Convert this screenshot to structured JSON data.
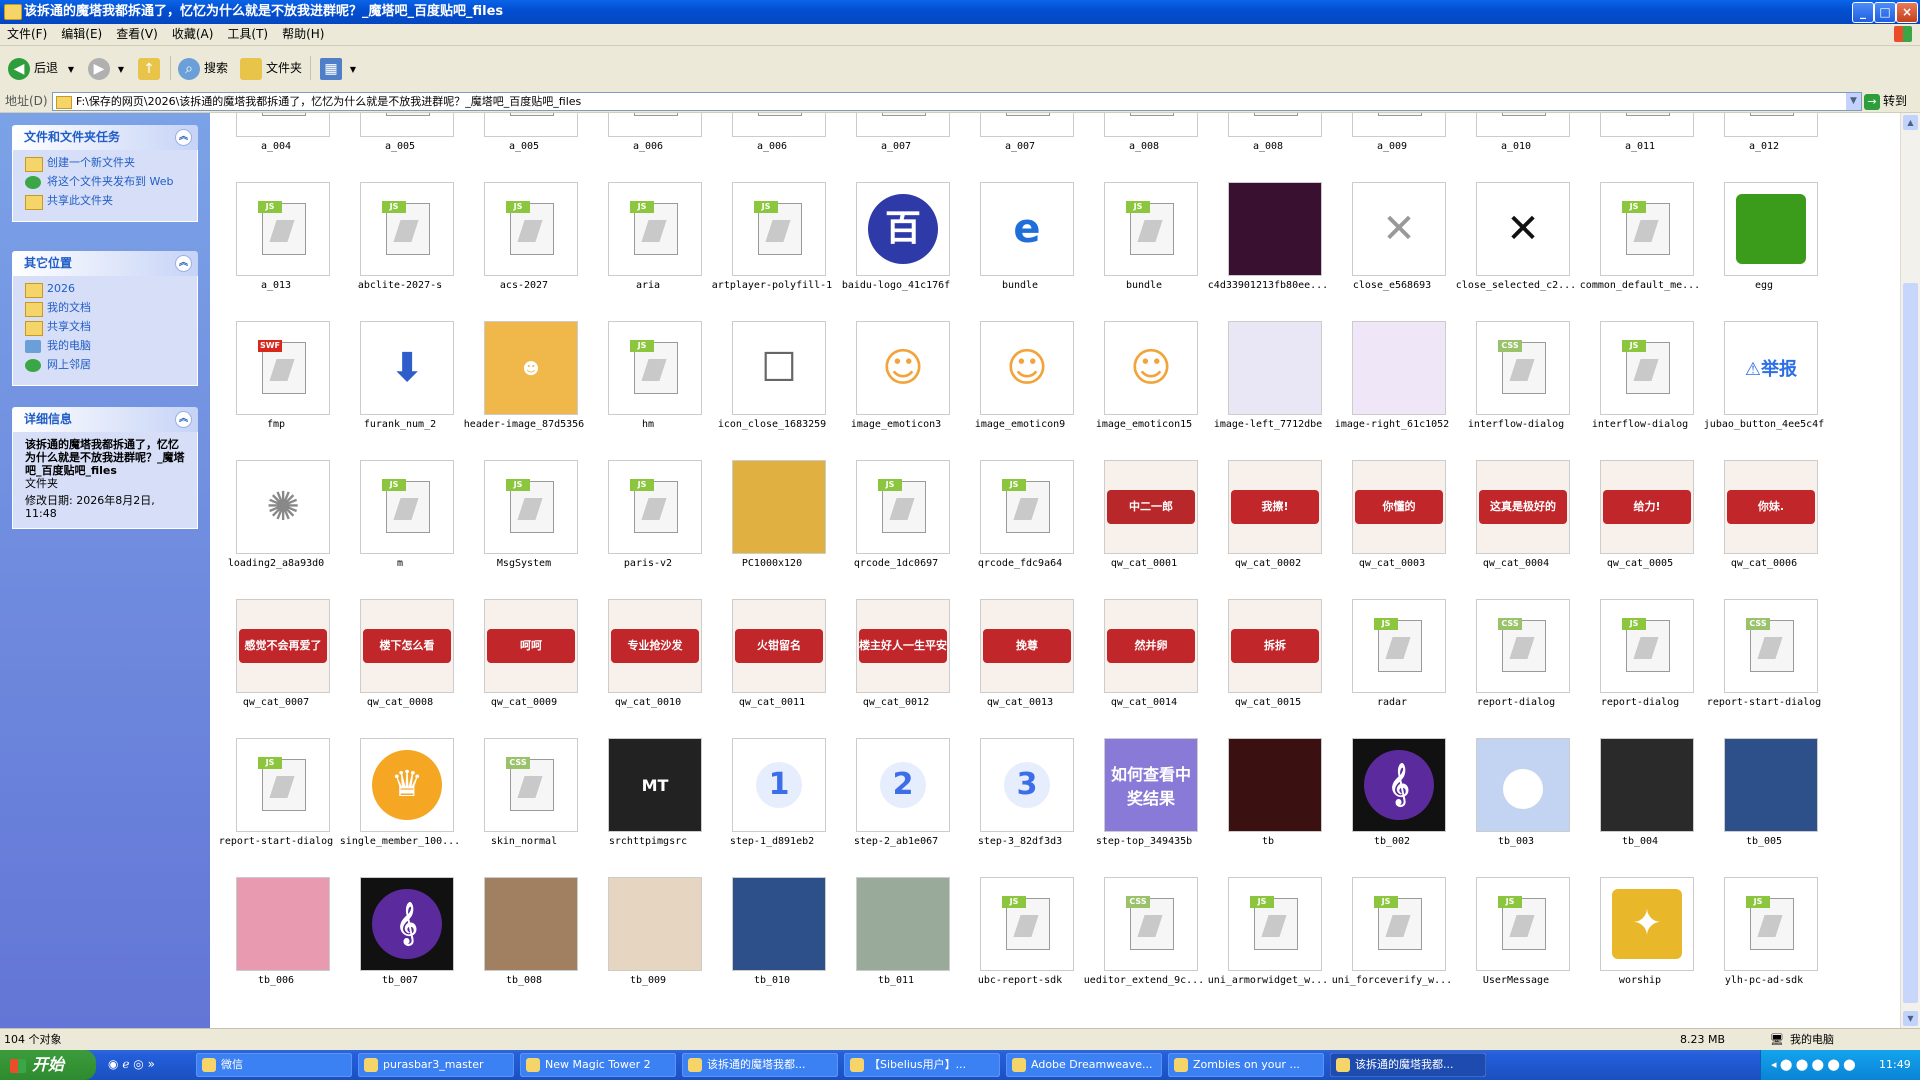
{
  "window": {
    "title": "该拆通的魔塔我都拆通了，忆忆为什么就是不放我进群呢？_魔塔吧_百度贴吧_files",
    "minimize": "_",
    "maximize": "□",
    "close": "×"
  },
  "menu": [
    "文件(F)",
    "编辑(E)",
    "查看(V)",
    "收藏(A)",
    "工具(T)",
    "帮助(H)"
  ],
  "toolbar": {
    "back": "后退",
    "search": "搜索",
    "folders": "文件夹"
  },
  "address": {
    "label": "地址(D)",
    "path": "F:\\保存的网页\\2026\\该拆通的魔塔我都拆通了，忆忆为什么就是不放我进群呢？_魔塔吧_百度贴吧_files",
    "go": "转到"
  },
  "tasks_panel": {
    "title": "文件和文件夹任务",
    "items": [
      "创建一个新文件夹",
      "将这个文件夹发布到 Web",
      "共享此文件夹"
    ]
  },
  "places_panel": {
    "title": "其它位置",
    "items": [
      "2026",
      "我的文档",
      "共享文档",
      "我的电脑",
      "网上邻居"
    ]
  },
  "details_panel": {
    "title": "详细信息",
    "name": "该拆通的魔塔我都拆通了，忆忆为什么就是不放我进群呢？_魔塔吧_百度贴吧_files",
    "type": "文件夹",
    "modified": "修改日期: 2026年8月2日, 11:48"
  },
  "file_rows": [
    [
      {
        "name": "a_004",
        "kind": "partial",
        "icon": "js-file-icon"
      },
      {
        "name": "a_005",
        "kind": "partial",
        "icon": "css-file-icon"
      },
      {
        "name": "a_005",
        "kind": "partial",
        "icon": "js-file-icon"
      },
      {
        "name": "a_006",
        "kind": "partial",
        "icon": "css-file-icon"
      },
      {
        "name": "a_006",
        "kind": "partial",
        "icon": "js-file-icon"
      },
      {
        "name": "a_007",
        "kind": "partial",
        "icon": "css-file-icon"
      },
      {
        "name": "a_007",
        "kind": "partial",
        "icon": "js-file-icon"
      },
      {
        "name": "a_008",
        "kind": "partial",
        "icon": "css-file-icon"
      },
      {
        "name": "a_008",
        "kind": "partial",
        "icon": "js-file-icon"
      },
      {
        "name": "a_009",
        "kind": "partial",
        "icon": "js-file-icon"
      },
      {
        "name": "a_010",
        "kind": "partial",
        "icon": "js-file-icon"
      },
      {
        "name": "a_011",
        "kind": "partial",
        "icon": "js-file-icon"
      },
      {
        "name": "a_012",
        "kind": "partial",
        "icon": "js-file-icon"
      }
    ],
    [
      {
        "name": "a_013",
        "kind": "js"
      },
      {
        "name": "abclite-2027-s",
        "kind": "js"
      },
      {
        "name": "acs-2027",
        "kind": "js"
      },
      {
        "name": "aria",
        "kind": "js"
      },
      {
        "name": "artplayer-polyfill-1",
        "kind": "js"
      },
      {
        "name": "baidu-logo_41c176f",
        "kind": "img",
        "icon": "baidu-tieba-logo-icon",
        "color": "#2e3aa8",
        "text": "百度贴吧"
      },
      {
        "name": "bundle",
        "kind": "img",
        "icon": "ie-icon",
        "color": "#1e6fd9",
        "text": "e"
      },
      {
        "name": "bundle",
        "kind": "js"
      },
      {
        "name": "c4d33901213fb80ee...",
        "kind": "img",
        "icon": "dark-banner-image",
        "color": "#3a1030"
      },
      {
        "name": "close_e568693",
        "kind": "img",
        "icon": "gray-close-x-icon",
        "color": "#999999",
        "text": "✕"
      },
      {
        "name": "close_selected_c2...",
        "kind": "img",
        "icon": "black-close-x-icon",
        "color": "#111111",
        "text": "✕"
      },
      {
        "name": "common_default_me...",
        "kind": "js"
      },
      {
        "name": "egg",
        "kind": "img",
        "icon": "green-egg-icon",
        "color": "#3a9c1a"
      }
    ],
    [
      {
        "name": "fmp",
        "kind": "swf"
      },
      {
        "name": "furank_num_2",
        "kind": "img",
        "icon": "small-arrow-icon",
        "color": "#2f5ecb",
        "text": "⬇"
      },
      {
        "name": "header-image_87d5356",
        "kind": "img",
        "icon": "emoji-header-image",
        "color": "#f0b84a",
        "text": "☻"
      },
      {
        "name": "hm",
        "kind": "js"
      },
      {
        "name": "icon_close_1683259",
        "kind": "img",
        "icon": "small-square-icon",
        "color": "#666666",
        "text": "☐"
      },
      {
        "name": "image_emoticon3",
        "kind": "img",
        "icon": "emoticon-icon",
        "color": "#f2a33a",
        "text": "☺"
      },
      {
        "name": "image_emoticon9",
        "kind": "img",
        "icon": "emoticon-icon",
        "color": "#f2a33a",
        "text": "☺"
      },
      {
        "name": "image_emoticon15",
        "kind": "img",
        "icon": "emoticon-icon",
        "color": "#f2a33a",
        "text": "☺"
      },
      {
        "name": "image-left_7712dbe",
        "kind": "img",
        "icon": "phone-screenshot-image",
        "color": "#e9e6f5"
      },
      {
        "name": "image-right_61c1052",
        "kind": "img",
        "icon": "phone-screenshot-image",
        "color": "#efe7f7"
      },
      {
        "name": "interflow-dialog",
        "kind": "css"
      },
      {
        "name": "interflow-dialog",
        "kind": "js"
      },
      {
        "name": "jubao_button_4ee5c4f",
        "kind": "img",
        "icon": "report-button-icon",
        "color": "#2c6fe6",
        "text": "⚠举报"
      }
    ],
    [
      {
        "name": "loading2_a8a93d0",
        "kind": "img",
        "icon": "loading-spinner-icon",
        "color": "#888888",
        "text": "✺"
      },
      {
        "name": "m",
        "kind": "js"
      },
      {
        "name": "MsgSystem",
        "kind": "js"
      },
      {
        "name": "paris-v2",
        "kind": "js"
      },
      {
        "name": "PC1000x120",
        "kind": "img",
        "icon": "banner-strip-image",
        "color": "#e0b040"
      },
      {
        "name": "qrcode_1dc0697",
        "kind": "js"
      },
      {
        "name": "qrcode_fdc9a64",
        "kind": "js"
      },
      {
        "name": "qw_cat_0001",
        "kind": "img",
        "icon": "cat-sticker-icon",
        "color": "#b8282a",
        "text": "中二一郎"
      },
      {
        "name": "qw_cat_0002",
        "kind": "img",
        "icon": "cat-sticker-icon",
        "color": "#c0262a",
        "text": "我擦!"
      },
      {
        "name": "qw_cat_0003",
        "kind": "img",
        "icon": "cat-sticker-icon",
        "color": "#c0262a",
        "text": "你懂的"
      },
      {
        "name": "qw_cat_0004",
        "kind": "img",
        "icon": "cat-sticker-icon",
        "color": "#c0262a",
        "text": "这真是极好的"
      },
      {
        "name": "qw_cat_0005",
        "kind": "img",
        "icon": "cat-sticker-icon",
        "color": "#c0262a",
        "text": "给力!"
      },
      {
        "name": "qw_cat_0006",
        "kind": "img",
        "icon": "cat-sticker-icon",
        "color": "#c0262a",
        "text": "你妹."
      }
    ],
    [
      {
        "name": "qw_cat_0007",
        "kind": "img",
        "icon": "cat-sticker-icon",
        "color": "#c0262a",
        "text": "感觉不会再爱了"
      },
      {
        "name": "qw_cat_0008",
        "kind": "img",
        "icon": "cat-sticker-icon",
        "color": "#c0262a",
        "text": "楼下怎么看"
      },
      {
        "name": "qw_cat_0009",
        "kind": "img",
        "icon": "cat-sticker-icon",
        "color": "#c0262a",
        "text": "呵呵"
      },
      {
        "name": "qw_cat_0010",
        "kind": "img",
        "icon": "cat-sticker-icon",
        "color": "#c0262a",
        "text": "专业抢沙发"
      },
      {
        "name": "qw_cat_0011",
        "kind": "img",
        "icon": "cat-sticker-icon",
        "color": "#c0262a",
        "text": "火钳留名"
      },
      {
        "name": "qw_cat_0012",
        "kind": "img",
        "icon": "cat-sticker-icon",
        "color": "#c0262a",
        "text": "楼主好人一生平安"
      },
      {
        "name": "qw_cat_0013",
        "kind": "img",
        "icon": "cat-sticker-icon",
        "color": "#c0262a",
        "text": "挽尊"
      },
      {
        "name": "qw_cat_0014",
        "kind": "img",
        "icon": "cat-sticker-icon",
        "color": "#c0262a",
        "text": "然并卵"
      },
      {
        "name": "qw_cat_0015",
        "kind": "img",
        "icon": "cat-sticker-icon",
        "color": "#c0262a",
        "text": "拆拆"
      },
      {
        "name": "radar",
        "kind": "js"
      },
      {
        "name": "report-dialog",
        "kind": "css"
      },
      {
        "name": "report-dialog",
        "kind": "js"
      },
      {
        "name": "report-start-dialog",
        "kind": "css"
      }
    ],
    [
      {
        "name": "report-start-dialog",
        "kind": "js"
      },
      {
        "name": "single_member_100...",
        "kind": "img",
        "icon": "crown-icon",
        "color": "#f5a623",
        "text": "♛"
      },
      {
        "name": "skin_normal",
        "kind": "css"
      },
      {
        "name": "srchttpimgsrc",
        "kind": "img",
        "icon": "dark-poster-image",
        "color": "#222222",
        "text": "MT"
      },
      {
        "name": "step-1_d891eb2",
        "kind": "img",
        "icon": "step-number-icon",
        "color": "#3b6ee8",
        "text": "1"
      },
      {
        "name": "step-2_ab1e067",
        "kind": "img",
        "icon": "step-number-icon",
        "color": "#3b6ee8",
        "text": "2"
      },
      {
        "name": "step-3_82df3d3",
        "kind": "img",
        "icon": "step-number-icon",
        "color": "#3b6ee8",
        "text": "3"
      },
      {
        "name": "step-top_349435b",
        "kind": "img",
        "icon": "banner-text-image",
        "color": "#8a7ad8",
        "text": "如何查看中奖结果"
      },
      {
        "name": "tb",
        "kind": "img",
        "icon": "monster-face-image",
        "color": "#3b1010"
      },
      {
        "name": "tb_002",
        "kind": "img",
        "icon": "sibelius-logo-icon",
        "color": "#5b2a9c",
        "text": "𝄞"
      },
      {
        "name": "tb_003",
        "kind": "img",
        "icon": "default-avatar-icon",
        "color": "#c3d4f2"
      },
      {
        "name": "tb_004",
        "kind": "img",
        "icon": "octopus-image",
        "color": "#2a2a2a"
      },
      {
        "name": "tb_005",
        "kind": "img",
        "icon": "anime-art-image",
        "color": "#2d4f8a"
      }
    ],
    [
      {
        "name": "tb_006",
        "kind": "img",
        "icon": "sunset-image",
        "color": "#e89ab0"
      },
      {
        "name": "tb_007",
        "kind": "img",
        "icon": "sibelius-logo-icon",
        "color": "#5b2a9c",
        "text": "𝄞"
      },
      {
        "name": "tb_008",
        "kind": "img",
        "icon": "bonsai-image",
        "color": "#a08060"
      },
      {
        "name": "tb_009",
        "kind": "img",
        "icon": "anime-girl-image",
        "color": "#e6d5c0"
      },
      {
        "name": "tb_010",
        "kind": "img",
        "icon": "anime-art-image",
        "color": "#2d4f8a"
      },
      {
        "name": "tb_011",
        "kind": "img",
        "icon": "sketch-art-image",
        "color": "#9aaa9a"
      },
      {
        "name": "ubc-report-sdk",
        "kind": "js"
      },
      {
        "name": "ueditor_extend_9c...",
        "kind": "css"
      },
      {
        "name": "uni_armorwidget_w...",
        "kind": "js"
      },
      {
        "name": "uni_forceverify_w...",
        "kind": "js"
      },
      {
        "name": "UserMessage",
        "kind": "js"
      },
      {
        "name": "worship",
        "kind": "img",
        "icon": "gold-star-icon",
        "color": "#e8b82a",
        "text": "✦"
      },
      {
        "name": "ylh-pc-ad-sdk",
        "kind": "js"
      }
    ]
  ],
  "status": {
    "count": "104 个对象",
    "size": "8.23 MB",
    "location": "我的电脑"
  },
  "taskbar": {
    "start": "开始",
    "tasks": [
      {
        "label": "微信",
        "active": false
      },
      {
        "label": "purasbar3_master",
        "active": false
      },
      {
        "label": "New Magic Tower 2",
        "active": false
      },
      {
        "label": "该拆通的魔塔我都...",
        "active": false
      },
      {
        "label": "【Sibelius用户】...",
        "active": false
      },
      {
        "label": "Adobe Dreamweave...",
        "active": false
      },
      {
        "label": "Zombies on your ...",
        "active": false
      },
      {
        "label": "该拆通的魔塔我都...",
        "active": true
      }
    ],
    "clock": "11:49"
  }
}
